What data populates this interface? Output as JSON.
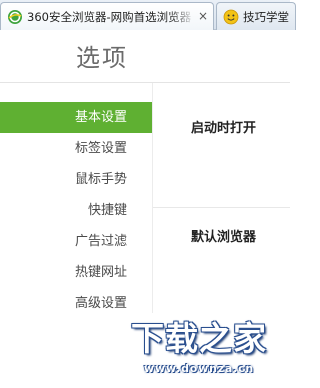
{
  "browser": {
    "tabs": [
      {
        "title": "360安全浏览器-网购首选浏览器",
        "icon": "360-browser-icon",
        "active": true
      },
      {
        "title": "技巧学堂",
        "icon": "smiley-icon",
        "active": false
      }
    ],
    "close_glyph": "×"
  },
  "page": {
    "title": "选项"
  },
  "nav": {
    "items": [
      {
        "label": "基本设置",
        "selected": true
      },
      {
        "label": "标签设置"
      },
      {
        "label": "鼠标手势"
      },
      {
        "label": "快捷键"
      },
      {
        "label": "广告过滤"
      },
      {
        "label": "热键网址"
      },
      {
        "label": "高级设置"
      }
    ]
  },
  "content": {
    "sections": [
      {
        "title": "启动时打开"
      },
      {
        "title": "默认浏览器"
      }
    ]
  },
  "watermark": {
    "text": "下载之家",
    "url": "www.downza.cn"
  },
  "colors": {
    "accent": "#5fb032",
    "selected_text": "#ffffff",
    "tabstrip": "#d6e0ec"
  }
}
